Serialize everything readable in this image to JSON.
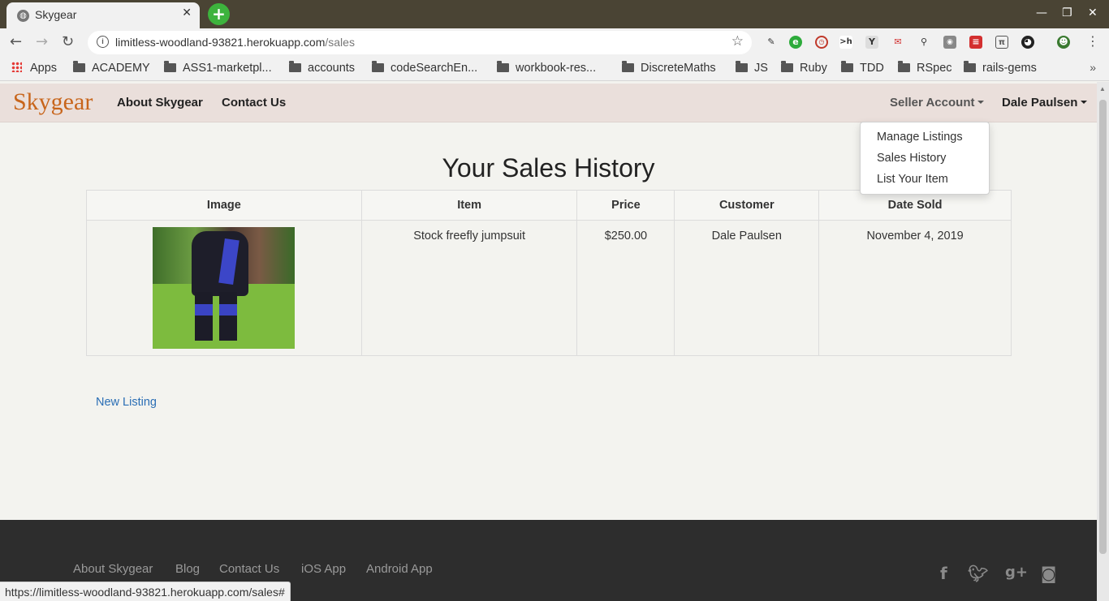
{
  "browser": {
    "tab_title": "Skygear",
    "tab_favicon": "globe-icon",
    "url_host": "limitless-woodland-93821.herokuapp.com",
    "url_path": "/sales",
    "status_url": "https://limitless-woodland-93821.herokuapp.com/sales#",
    "bookmarks": [
      "Apps",
      "ACADEMY",
      "ASS1-marketpl...",
      "accounts",
      "codeSearchEn...",
      "workbook-res...",
      "DiscreteMaths",
      "JS",
      "Ruby",
      "TDD",
      "RSpec",
      "rails-gems"
    ]
  },
  "site": {
    "brand": "Skygear",
    "brand_color": "#c8651b",
    "nav": {
      "about": "About Skygear",
      "contact": "Contact Us",
      "seller_account": "Seller Account",
      "user": "Dale Paulsen"
    },
    "dropdown": [
      "Manage Listings",
      "Sales History",
      "List Your Item"
    ]
  },
  "main": {
    "heading": "Your Sales History",
    "columns": [
      "Image",
      "Item",
      "Price",
      "Customer",
      "Date Sold"
    ],
    "rows": [
      {
        "image": "jumpsuit-photo",
        "item": "Stock freefly jumpsuit",
        "price": "$250.00",
        "customer": "Dale Paulsen",
        "date_sold": "November 4, 2019"
      }
    ],
    "new_listing": "New Listing",
    "link_color": "#2a6eb5"
  },
  "footer": {
    "links": [
      "About Skygear",
      "Blog",
      "Contact Us",
      "iOS App",
      "Android App"
    ],
    "social_icons": [
      "facebook-icon",
      "twitter-icon",
      "google-plus-icon",
      "instagram-icon"
    ]
  }
}
